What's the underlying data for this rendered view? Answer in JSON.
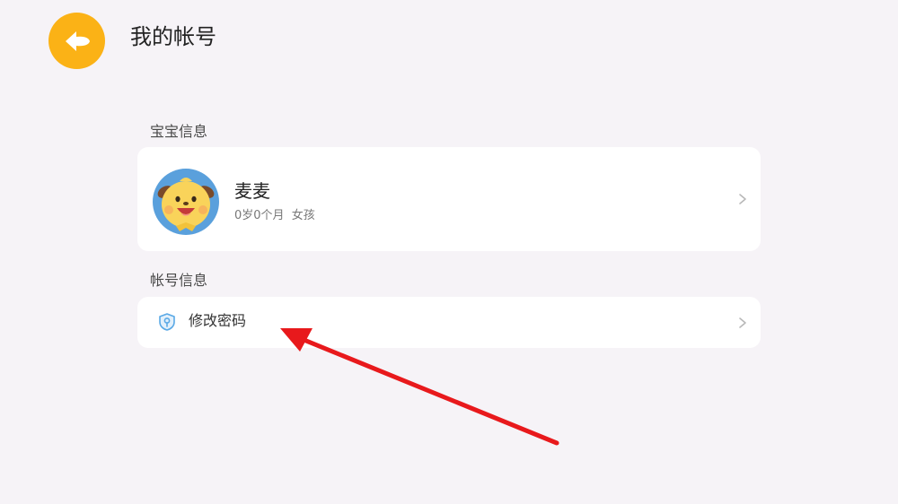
{
  "header": {
    "title": "我的帐号",
    "back_icon": "back-arrow-icon"
  },
  "baby_section": {
    "title": "宝宝信息",
    "name": "麦麦",
    "meta": "0岁0个月  女孩",
    "avatar_icon": "cartoon-dog-avatar"
  },
  "account_section": {
    "title": "帐号信息",
    "items": [
      {
        "label": "修改密码",
        "icon": "shield-key-icon"
      }
    ]
  },
  "colors": {
    "background": "#f6f3f7",
    "accent": "#fbb216",
    "card": "#ffffff",
    "annotation_arrow": "#e8191c",
    "icon_blue": "#5aa9e6"
  }
}
